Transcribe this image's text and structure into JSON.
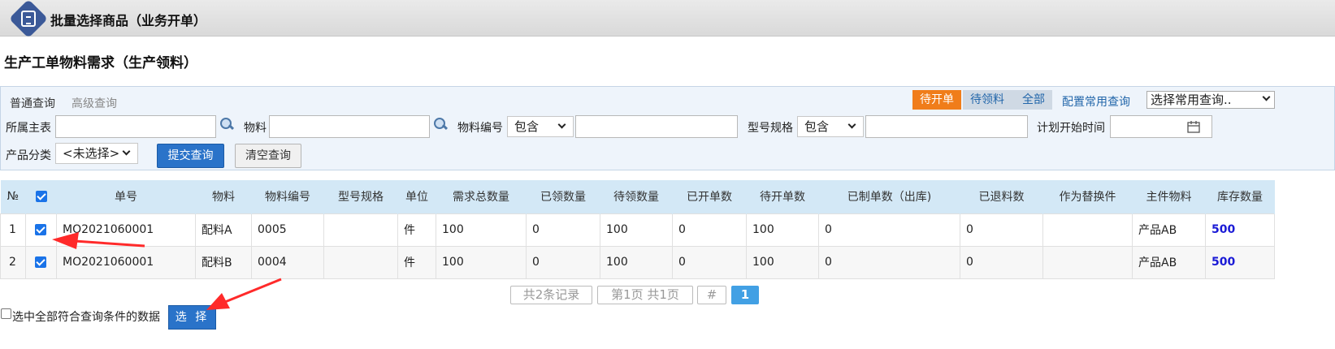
{
  "header": {
    "title": "批量选择商品（业务开单）"
  },
  "section_title": "生产工单物料需求（生产领料）",
  "query": {
    "tabs": [
      "普通查询",
      "高级查询"
    ],
    "status_buttons": [
      "待开单",
      "待领料",
      "全部"
    ],
    "config_link": "配置常用查询",
    "common_select": "选择常用查询..",
    "fields": {
      "main_table": "所属主表",
      "material": "物料",
      "material_code": "物料编号",
      "match_mode": "包含",
      "model_spec": "型号规格",
      "plan_start": "计划开始时间",
      "product_category": "产品分类",
      "category_value": "<未选择>"
    },
    "submit": "提交查询",
    "clear": "清空查询"
  },
  "table": {
    "headers": [
      "№",
      "单号",
      "物料",
      "物料编号",
      "型号规格",
      "单位",
      "需求总数量",
      "已领数量",
      "待领数量",
      "已开单数",
      "待开单数",
      "已制单数（出库)",
      "已退料数",
      "作为替换件",
      "主件物料",
      "库存数量"
    ],
    "rows": [
      {
        "no": "1",
        "order": "MO2021060001",
        "material": "配料A",
        "code": "0005",
        "spec": "",
        "unit": "件",
        "total": "100",
        "received": "0",
        "pending": "100",
        "opened": "0",
        "to_open": "100",
        "made": "0",
        "returned": "0",
        "replacement": "",
        "main": "产品AB",
        "stock": "500"
      },
      {
        "no": "2",
        "order": "MO2021060001",
        "material": "配料B",
        "code": "0004",
        "spec": "",
        "unit": "件",
        "total": "100",
        "received": "0",
        "pending": "100",
        "opened": "0",
        "to_open": "100",
        "made": "0",
        "returned": "0",
        "replacement": "",
        "main": "产品AB",
        "stock": "500"
      }
    ]
  },
  "pager": {
    "records": "共2条记录",
    "pages": "第1页 共1页",
    "jump": "#",
    "current": "1"
  },
  "footer": {
    "select_all_label": "选中全部符合查询条件的数据",
    "select_button": "选 择"
  },
  "colors": {
    "accent_orange": "#f07d1a",
    "primary_blue": "#2a73c9",
    "header_blue": "#d3e8f6",
    "stock_blue": "#1a1ad6",
    "annotation_red": "#ff2a2a"
  }
}
